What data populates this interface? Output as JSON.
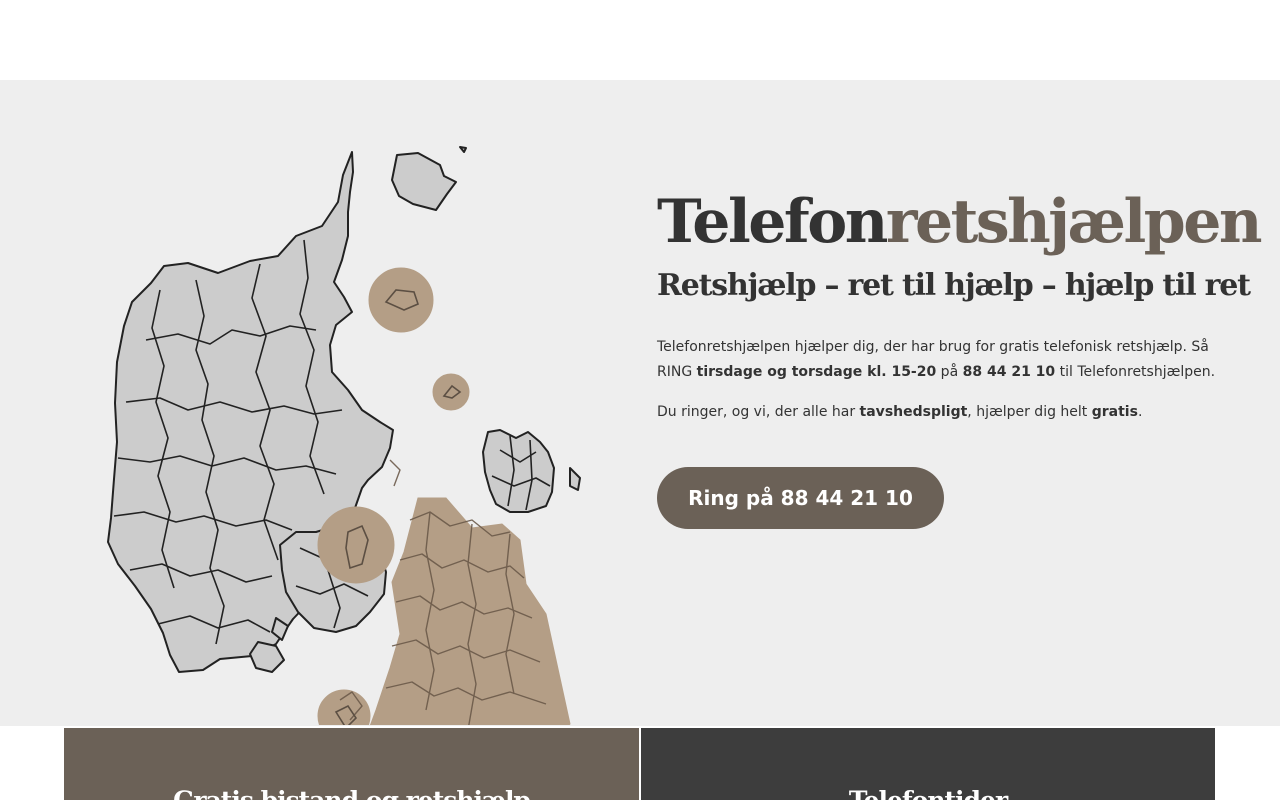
{
  "hero": {
    "title_part1": "Telefon",
    "title_part2": "retshjælpen",
    "subtitle": "Retshjælp – ret til hjælp – hjælp til ret",
    "para1": {
      "text1": "Telefonretshjælpen hjælper dig, der har brug for gratis telefonisk retshjælp. Så RING ",
      "bold1": "tirsdage og torsdage kl. 15-20",
      "text2": " på ",
      "bold2": "88 44 21 10",
      "text3": " til Telefonretshjælpen."
    },
    "para2": {
      "text1": "Du ringer, og vi, der alle har ",
      "bold1": "tavshedspligt",
      "text2": ", hjælper dig helt ",
      "bold2": "gratis",
      "text3": "."
    },
    "cta_label": "Ring på 88 44 21 10"
  },
  "cards": [
    {
      "title": "Gratis bistand og retshjælp"
    },
    {
      "title": "Telefontider"
    }
  ],
  "colors": {
    "brand": "#6b6157",
    "dark": "#3d3d3d",
    "hero_bg": "#eeeeee",
    "map_fill": "#cccccc",
    "map_highlight": "#b49e86"
  }
}
